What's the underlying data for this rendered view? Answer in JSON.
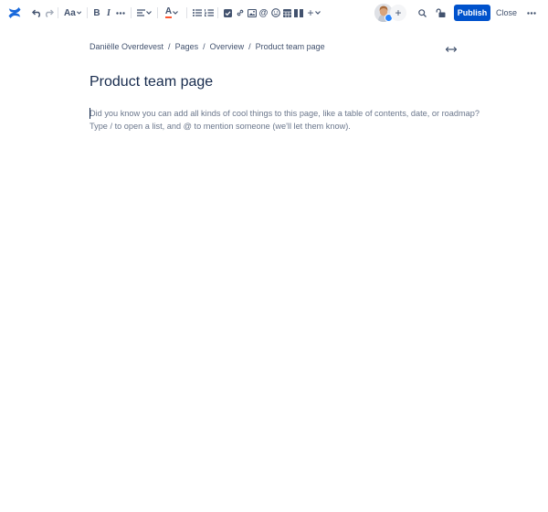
{
  "toolbar": {
    "logo_icon": "confluence-logo",
    "undo_icon": "undo-icon",
    "redo_icon": "redo-icon",
    "text_style_label": "Aa",
    "bold_label": "B",
    "italic_label": "I",
    "more_formatting_icon": "more-icon",
    "alignment_icon": "align-left-icon",
    "text_color_label": "A",
    "text_color": "#FF5630",
    "bullet_list_icon": "bullet-list-icon",
    "numbered_list_icon": "numbered-list-icon",
    "action_item_icon": "checkbox-icon",
    "link_icon": "link-icon",
    "image_icon": "image-icon",
    "mention_label": "@",
    "emoji_icon": "emoji-icon",
    "table_icon": "table-icon",
    "layouts_icon": "layouts-icon",
    "insert_label": "+",
    "collaborators_icon": "avatar",
    "invite_label": "+",
    "find_icon": "search-icon",
    "restrictions_icon": "unlock-icon",
    "publish_label": "Publish",
    "close_label": "Close",
    "more_actions_icon": "more-icon"
  },
  "breadcrumb": [
    "Daniëlle Overdevest",
    "Pages",
    "Overview",
    "Product team page"
  ],
  "page": {
    "title": "Product team page",
    "placeholder_line1": "Did you know you can add all kinds of cool things to this page, like a table of contents, date, or roadmap?",
    "placeholder_line2": "Type / to open a list, and @ to mention someone (we'll let them know)."
  },
  "colors": {
    "brand": "#0052CC",
    "logo": "#1868DB",
    "text": "#172B4D",
    "subtle_text": "#42526E",
    "placeholder": "#6B778C"
  }
}
